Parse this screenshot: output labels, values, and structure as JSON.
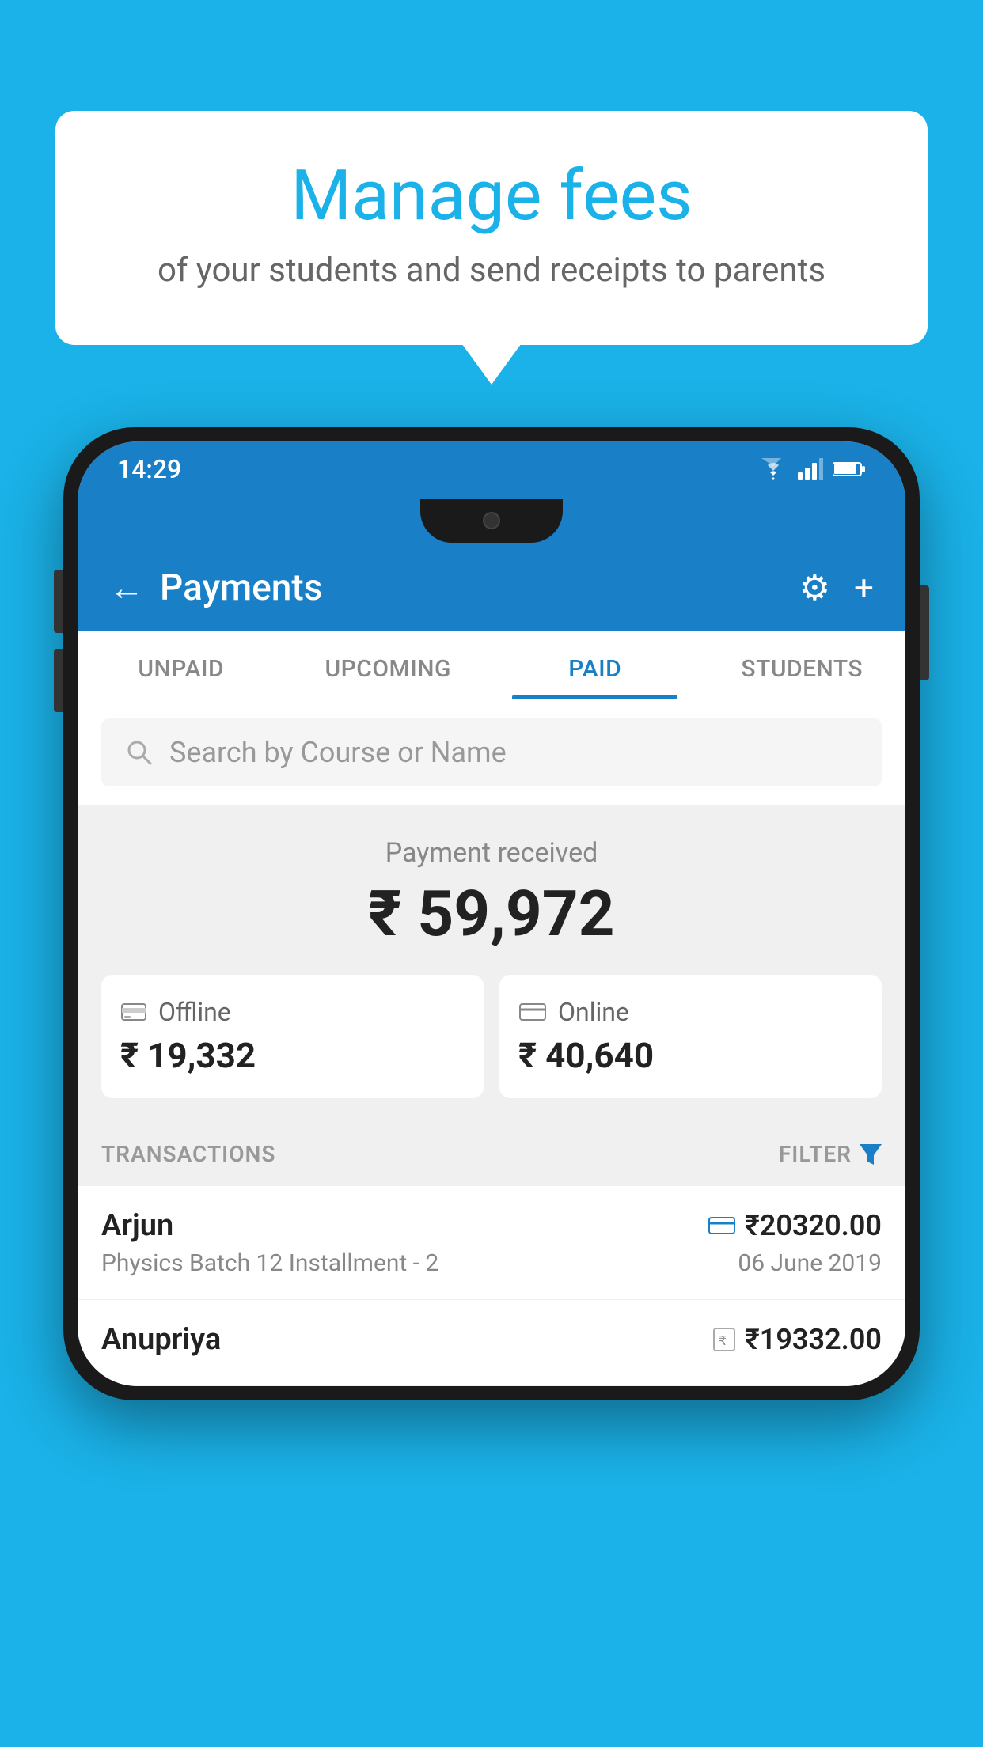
{
  "background_color": "#1ab2e8",
  "bubble": {
    "title": "Manage fees",
    "subtitle": "of your students and send receipts to parents"
  },
  "status_bar": {
    "time": "14:29",
    "wifi": "wifi",
    "signal": "signal",
    "battery": "battery"
  },
  "header": {
    "title": "Payments",
    "back_label": "←",
    "settings_icon": "⚙",
    "add_icon": "+"
  },
  "tabs": [
    {
      "id": "unpaid",
      "label": "UNPAID",
      "active": false
    },
    {
      "id": "upcoming",
      "label": "UPCOMING",
      "active": false
    },
    {
      "id": "paid",
      "label": "PAID",
      "active": true
    },
    {
      "id": "students",
      "label": "STUDENTS",
      "active": false
    }
  ],
  "search": {
    "placeholder": "Search by Course or Name"
  },
  "payment_received": {
    "label": "Payment received",
    "amount": "₹ 59,972",
    "offline": {
      "type": "Offline",
      "amount": "₹ 19,332"
    },
    "online": {
      "type": "Online",
      "amount": "₹ 40,640"
    }
  },
  "transactions": {
    "header": "TRANSACTIONS",
    "filter": "FILTER",
    "items": [
      {
        "name": "Arjun",
        "amount": "₹20320.00",
        "desc": "Physics Batch 12 Installment - 2",
        "date": "06 June 2019",
        "payment_type": "card"
      },
      {
        "name": "Anupriya",
        "amount": "₹19332.00",
        "desc": "",
        "date": "",
        "payment_type": "rupee"
      }
    ]
  }
}
